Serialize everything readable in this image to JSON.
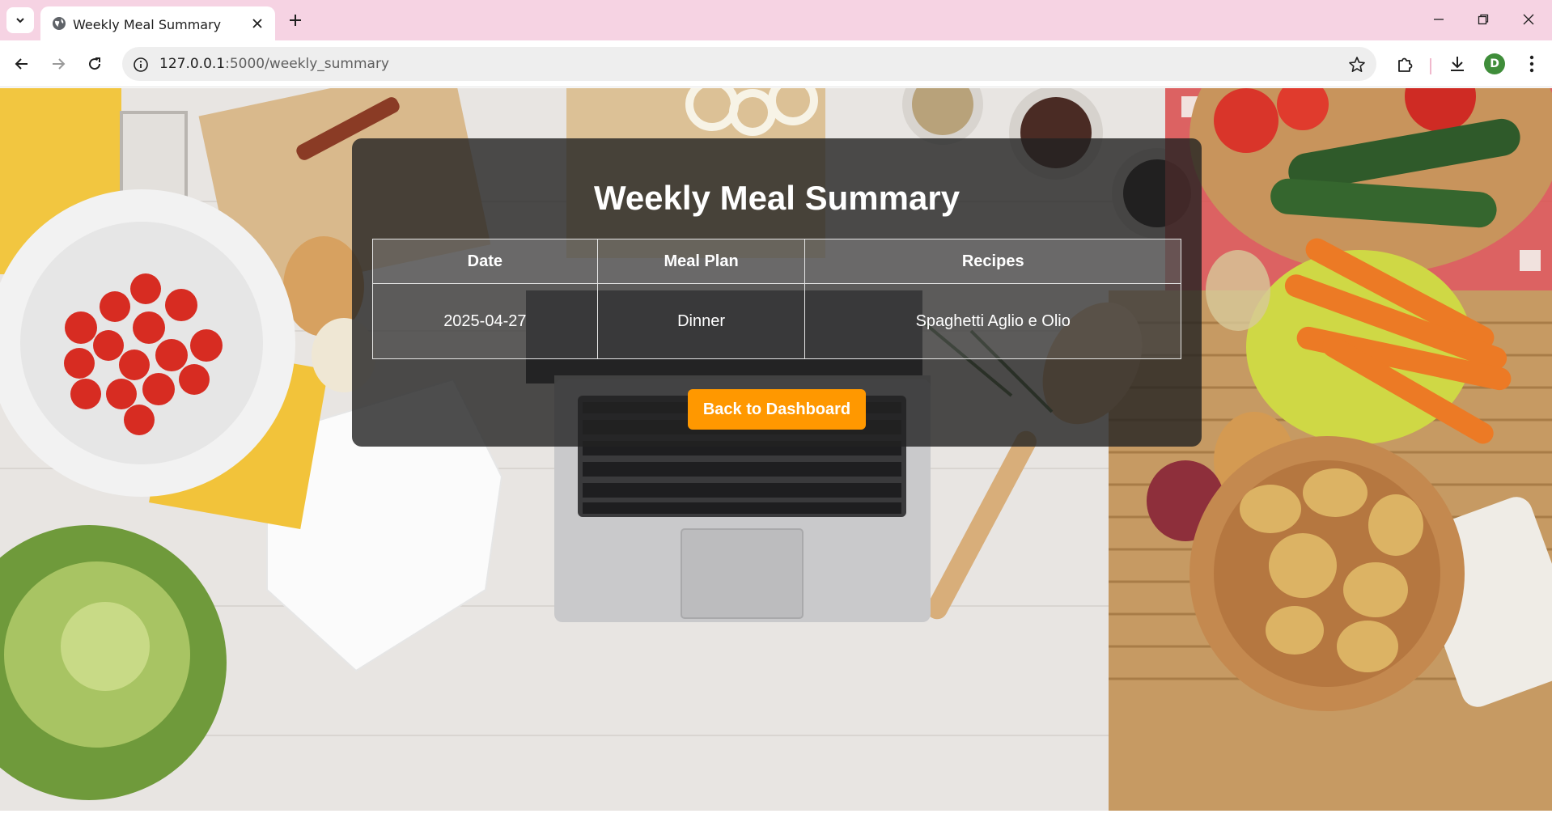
{
  "browser": {
    "tab_title": "Weekly Meal Summary",
    "url_host": "127.0.0.1",
    "url_rest": ":5000/weekly_summary",
    "profile_initial": "D",
    "frame_color": "#f6d3e3"
  },
  "page": {
    "title": "Weekly Meal Summary",
    "table": {
      "headers": [
        "Date",
        "Meal Plan",
        "Recipes"
      ],
      "rows": [
        [
          "2025-04-27",
          "Dinner",
          "Spaghetti Aglio e Olio"
        ]
      ]
    },
    "back_button_label": "Back to Dashboard",
    "accent_color": "#ff9800"
  }
}
